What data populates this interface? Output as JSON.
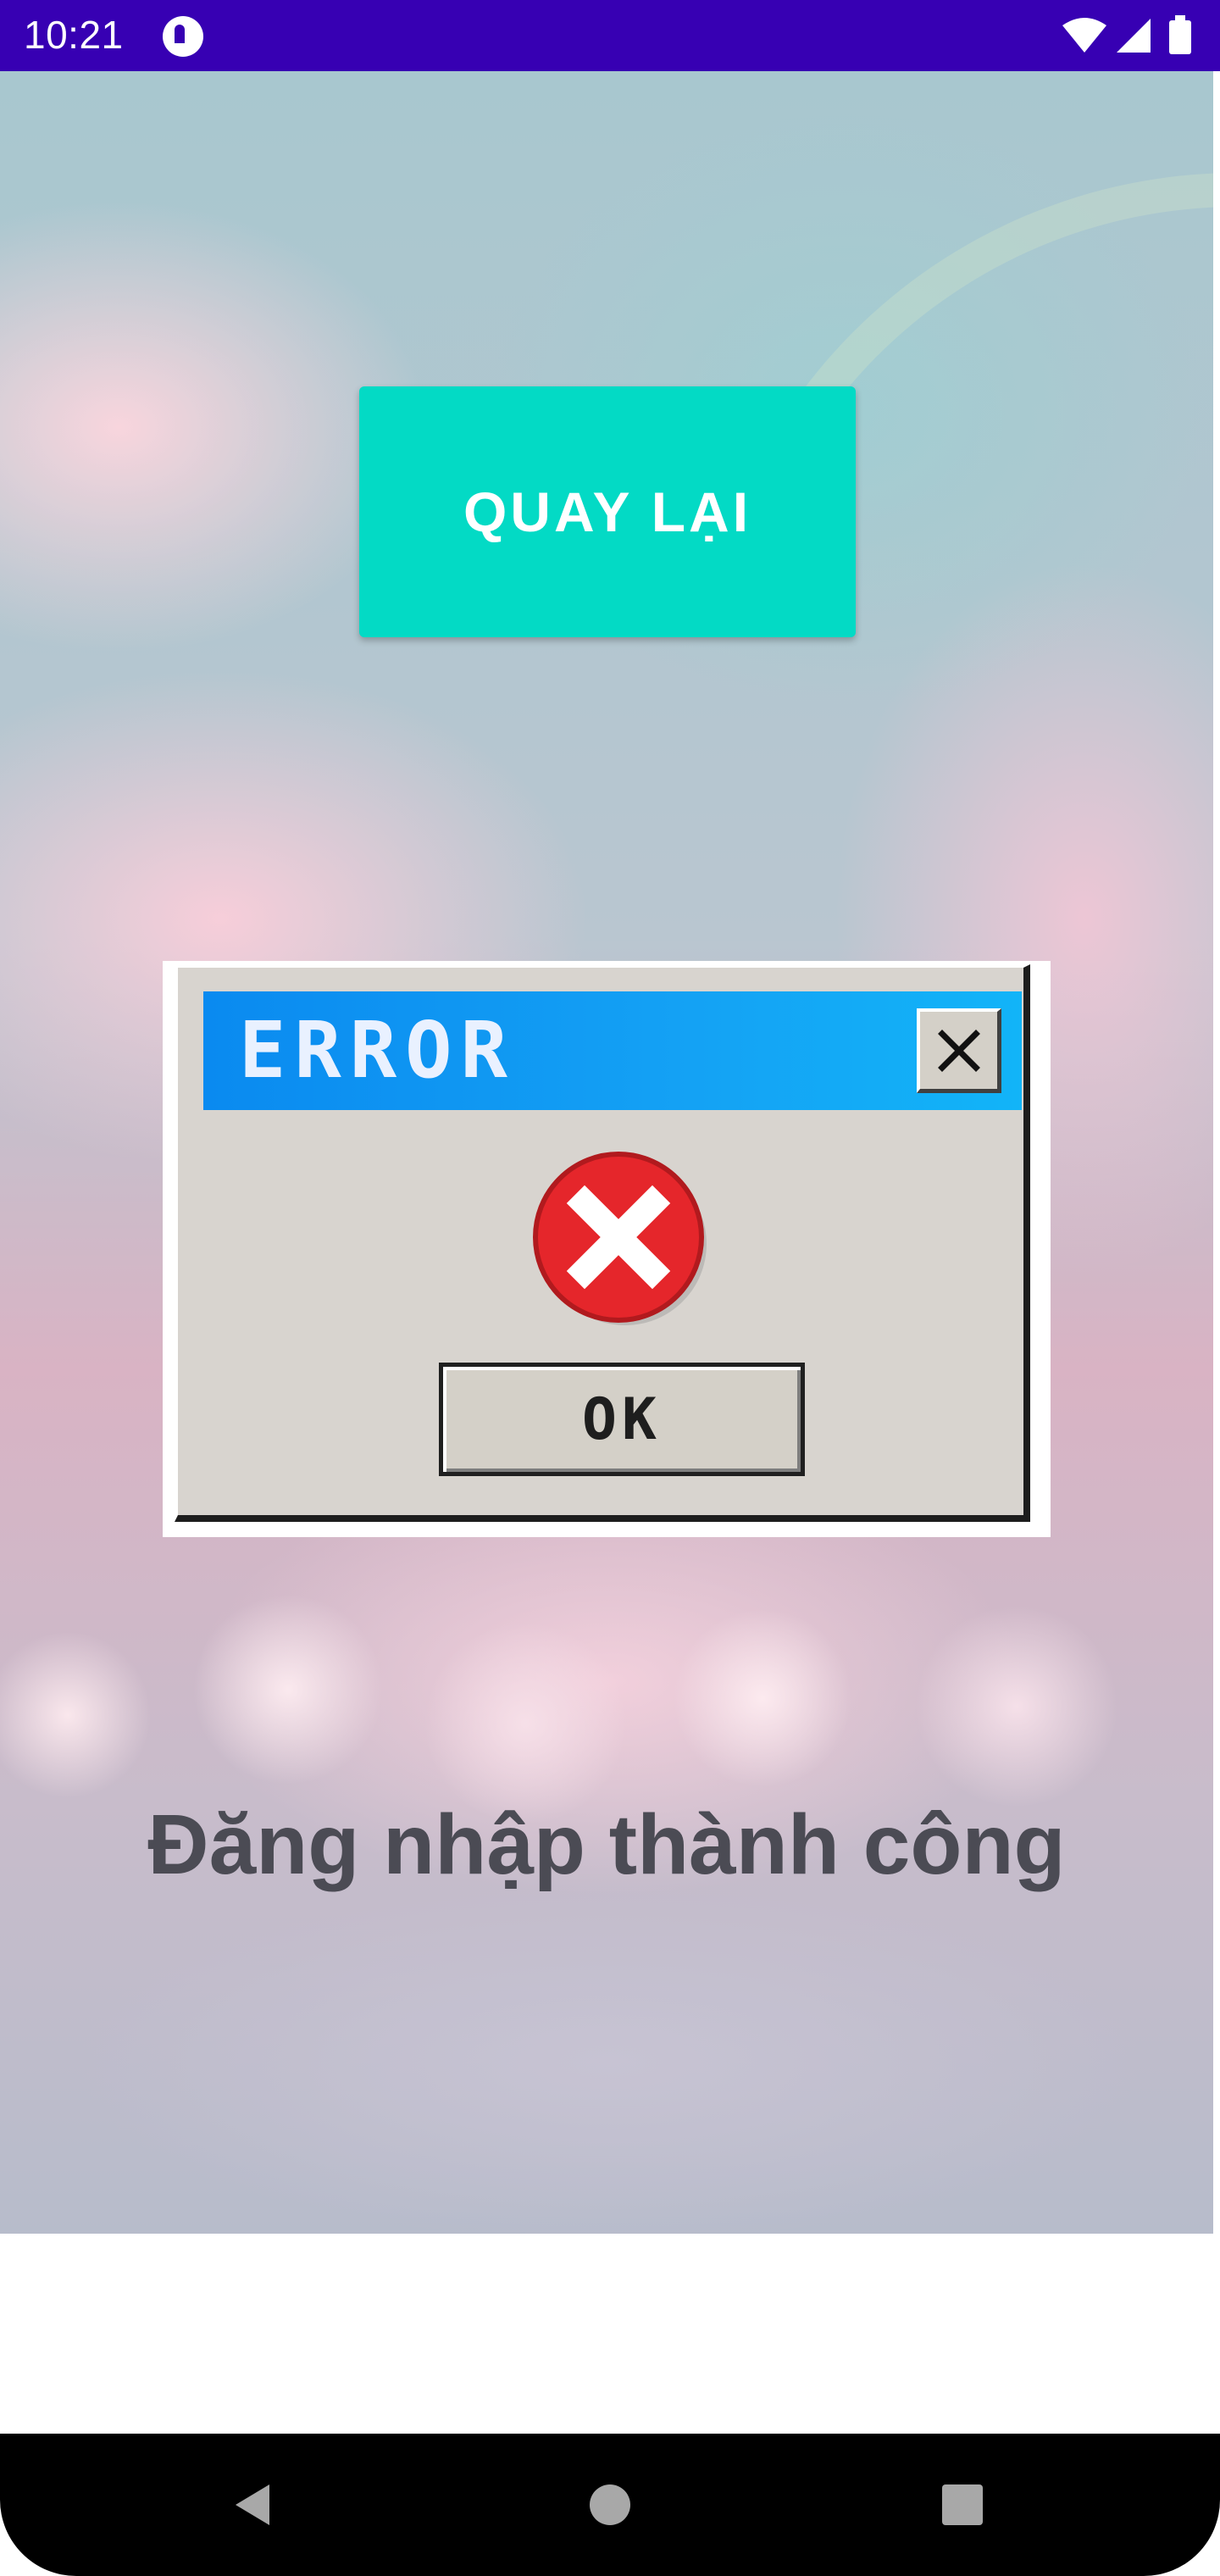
{
  "status_bar": {
    "time": "10:21",
    "icons": [
      "app-notification-icon",
      "wifi-icon",
      "signal-icon",
      "battery-icon"
    ],
    "color": "#3700b3"
  },
  "main": {
    "back_button_label": "QUAY LẠI",
    "back_button_color": "#03dac5",
    "error_dialog": {
      "title": "ERROR",
      "ok_label": "OK",
      "icons": [
        "close-icon",
        "error-x-icon"
      ]
    },
    "success_message": "Đăng nhập thành công"
  },
  "nav_bar": {
    "buttons": [
      "back-triangle-icon",
      "home-circle-icon",
      "recents-square-icon"
    ]
  }
}
